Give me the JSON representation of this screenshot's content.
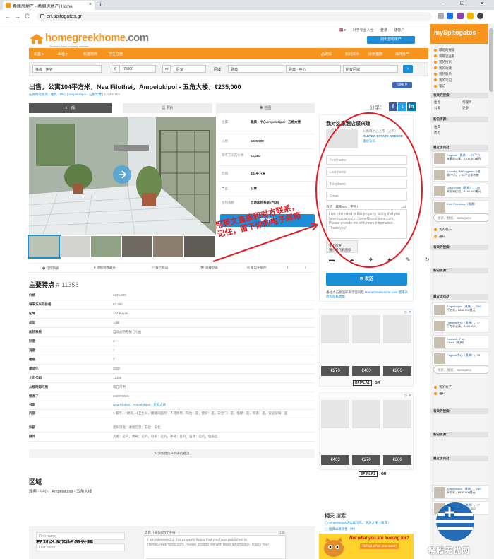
{
  "browser": {
    "tab_title": "希腊房地产 - 希腊房地产| Home",
    "tab_close": "×",
    "new_tab": "+",
    "url": "en.spitogatos.gr",
    "nav_back": "←",
    "nav_forward": "→",
    "nav_reload": "C",
    "window_controls": "– ☐ ✕"
  },
  "header": {
    "logo_main": "homegreekhome",
    "logo_suffix": ".com",
    "logo_tag": "Greece's Next property website",
    "top_links": [
      "🇬🇧 ▾",
      "对于专业人士",
      "登录",
      "建帐户"
    ],
    "post_button": "列出您的房产"
  },
  "nav": [
    "出售 ▾",
    "出租 ▾",
    "新建筑商",
    "学生住宿"
  ],
  "search": {
    "type": "独栋 : 住宅",
    "price": "75000",
    "rooms_label": "卧室",
    "area_label": "区域",
    "area_value": "雅典",
    "region": "雅典 - 中心",
    "all_areas": "所有区域",
    "euro": "€",
    "m2": "m²"
  },
  "listing": {
    "title": "出售，公寓104平方米，Nea Filothei，Ampelokipoi - 五角大楼，€235,000",
    "breadcrumb": [
      "在你附近投资",
      "雅典 - 中心",
      "Ampelokipoi - 五角大楼"
    ],
    "id_text": "1, 8484182",
    "like": "Like 0",
    "tabs": [
      "一般",
      "照片",
      "地图"
    ],
    "share_label": "分享：",
    "info": [
      {
        "label": "位置",
        "value": "雅典 - 中心Ampelokipoi - 五角大楼"
      },
      {
        "label": "价格",
        "value": "€235,000"
      },
      {
        "label": "每平方米的价格",
        "value": "€2,260"
      },
      {
        "label": "区域",
        "value": "104平方米"
      },
      {
        "label": "类型",
        "value": "公寓"
      },
      {
        "label": "加热系统",
        "value": "自动加热系统 (汽油)"
      }
    ],
    "call_button": "呼叫",
    "actions": [
      "打印列表",
      "添加到收藏夹",
      "报告错误",
      "隐藏列表",
      "发电子邮件"
    ]
  },
  "features": {
    "title": "主要特点",
    "id": "# 11358",
    "rows": [
      {
        "label": "价格",
        "value": "€235,000"
      },
      {
        "label": "每平方米的价格",
        "value": "€2,260"
      },
      {
        "label": "区域",
        "value": "104平方米"
      },
      {
        "label": "类型",
        "value": "公寓"
      },
      {
        "label": "加热系统",
        "value": "自动加热系统 (汽油)"
      },
      {
        "label": "卧室",
        "value": "2"
      },
      {
        "label": "浴室",
        "value": "1"
      },
      {
        "label": "楼层",
        "value": "2"
      },
      {
        "label": "建造年",
        "value": "2000"
      },
      {
        "label": "上市代码",
        "value": "11358"
      },
      {
        "label": "从那时起可用",
        "value": "现在可用"
      },
      {
        "label": "修改了",
        "value": "24/07/2019"
      },
      {
        "label": "邻里",
        "value": "Nea Filothei，Ampelokipoi - 五角大楼"
      },
      {
        "label": "内部",
        "value": "1 餐厅，1厨房，1卫生间，储藏间面积：不可调用，阳台：是，壁炉：是，安全门：是，电梯：是，雨篷：是，双层玻璃：是"
      },
      {
        "label": "外部",
        "value": "遮阳篷框：进程信息，方位：东北"
      },
      {
        "label": "额外",
        "value": "灭菌：是的，烤箱：是的，取暖：是的，冰箱：是的，空调：是的，住宅区"
      }
    ],
    "report": "添加此房产列表的备注"
  },
  "region": {
    "heading": "区域",
    "text": "雅典 - 中心，Ampelokipoi - 五角大楼"
  },
  "contact_bottom": {
    "title_pre": "我对这家酒店",
    "title_bold": "感兴趣",
    "first_name": "First name",
    "last_name": "Last name",
    "msg_label": "消息（最多600个字符）",
    "msg_count": "138",
    "msg_text": "I am interested in this property listing that you have published in HomeGreekHome.com. Please provide me with more information. Thank you!"
  },
  "contact_card": {
    "title_pre": "我对这家酒店",
    "title_bold": "感兴趣",
    "agent_sub": "从雅典中心上市（上市）",
    "agent_name": "CLEVER ESTATE GREECE",
    "agent_link": "电话号码",
    "first_name": "First name",
    "last_name": "Last name",
    "telephone": "Telephone",
    "email": "Email",
    "msg_label": "消息（最多600个字符）",
    "msg_count": "138",
    "msg_text": "I am interested in this property listing that you have published in HomeGreekHome.com. Please provide me with more information. Thank you!",
    "captcha_text": "安全检查\n请点击飞机图标",
    "captcha_icons": "▬ ☁ ✈ ♣ ✎ ↻",
    "send_button": "发送",
    "terms": "通过点击发送即表示您同意",
    "terms_link": "HomeGreekHome.com 使用条款和隐私政策"
  },
  "annotation": {
    "line1": "用英文直接和对方联系，",
    "line2": "记住，留下你的电子邮箱"
  },
  "ads": {
    "prices_1": [
      "€270",
      "€463",
      "€286"
    ],
    "prices_2": [
      "€463",
      "€270",
      "€286"
    ],
    "brand": "EPIPLA1",
    "brand_suffix": "GR",
    "ad_mark": "▷ ✕"
  },
  "related": {
    "title_bold": "相关",
    "title_rest": "搜索",
    "links": [
      "Ampelokipoi的公寓出售，五角大楼（雅典）",
      "雅典公寓销售（中）"
    ]
  },
  "footer_ad": {
    "headline": "Not what you are looking for?",
    "sub": "Tell us what you want!"
  },
  "sidebar": {
    "title": "mySpitogatos",
    "menu": [
      "最近的搜索",
      "我最近查看",
      "我的搜索",
      "我的收藏",
      "我的联系",
      "我的笔记",
      "笔记"
    ],
    "section_properties": "有效的搜索：",
    "section_props2": "新的房源：",
    "section_recent": "最近访问过：",
    "tags": [
      "出售",
      "公寓",
      "出租",
      "雅典",
      "代理商",
      "更多"
    ],
    "cards": [
      {
        "title": "Pagkrati（雅典），75平方",
        "sub": "米套房公寓，€105,000美元"
      },
      {
        "title": "Koukaki - Makrygianni（雅",
        "sub": "典-中心），69平方米的房"
      },
      {
        "title": "Lofos Strefi（雅典），175",
        "sub": "平方米住宅，€245,000美元"
      },
      {
        "title": "Kato Petralona（雅典）",
        "sub": ""
      },
      {
        "title": "Ampelokipoi（雅典），240",
        "sub": "平方米，€830,000美元"
      },
      {
        "title": "Pagkrati中心（雅典），77",
        "sub": "平方米公寓，€154,000"
      },
      {
        "title": "Koukaki - Psiri",
        "sub": "Chara（雅典）"
      },
      {
        "title": "Pagkrati中心（雅典），78",
        "sub": ""
      },
      {
        "title": "Ampelokipoi（雅典），240",
        "sub": "平方米，€830,000美元"
      },
      {
        "title": "Pagkrati中心（雅典），77",
        "sub": "平方米公寓，€154,000"
      }
    ],
    "search_placeholder": "搜索，搜索，Spitogatos",
    "links2": [
      "我的帖子",
      "通知"
    ],
    "watermark": "希腊无忧网"
  }
}
